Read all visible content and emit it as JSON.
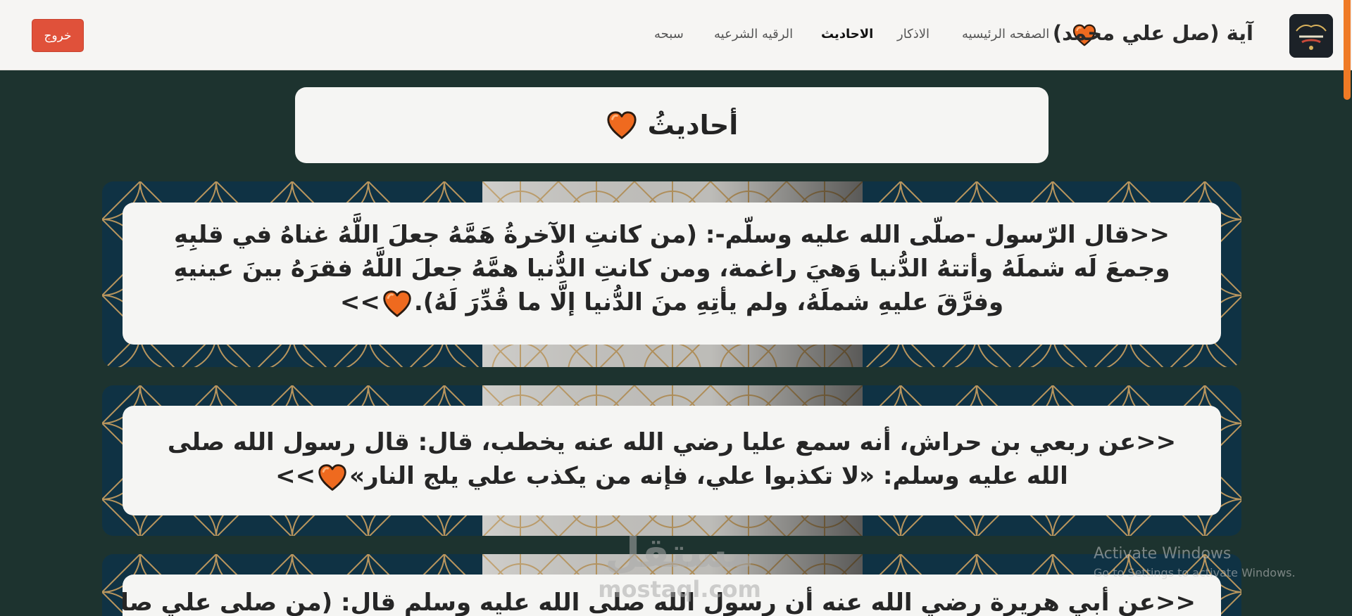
{
  "navbar": {
    "brand_title": "آية (صل علي محمد)",
    "brand_icon": "heart-icon",
    "links": [
      {
        "label": "الصفحه الرئيسيه",
        "active": false
      },
      {
        "label": "الاذكار",
        "active": false
      },
      {
        "label": "الاحاديث",
        "active": true
      },
      {
        "label": "الرقيه الشرعيه",
        "active": false
      },
      {
        "label": "سبحه",
        "active": false
      }
    ],
    "logout_label": "خروج"
  },
  "page": {
    "heading": "أحاديثُ"
  },
  "hadiths": [
    {
      "text": "<<قال الرّسول -صلّى الله عليه وسلّم-: (من كانتِ الآخرةُ هَمَّهُ جعلَ اللَّهُ غناهُ في قلبِهِ وجمعَ لَه شملَهُ وأتتهُ الدُّنيا وَهيَ راغمة، ومن كانتِ الدُّنيا همَّهُ جعلَ اللَّهُ فقرَهُ بينَ عينيهِ وفرَّقَ عليهِ شملَهُ، ولم يأتِهِ منَ الدُّنيا إلَّا ما قُدِّرَ لَهُ)."
    },
    {
      "text": "<<عن ربعي بن حراش، أنه سمع عليا رضي الله عنه يخطب، قال: قال رسول الله صلى الله عليه وسلم: «لا تكذبوا علي، فإنه من يكذب علي يلج النار»"
    },
    {
      "text": "<<عن أبي هريرة رضي الله عنه أن رسول الله صلى الله عليه وسلم قال: (من صلى علي صلاة"
    }
  ],
  "hadith_end_marker": ">>",
  "overlay": {
    "watermark_arabic": "مستقل",
    "watermark_site": "mostaql.com",
    "activate_title": "Activate Windows",
    "activate_subtitle": "Go to Settings to activate Windows."
  },
  "colors": {
    "page_background": "#1d332f",
    "navbar_background": "#f6f5f3",
    "logout_button": "#e0513a",
    "heart": "#ef6a1f",
    "pattern_dark": "#0f3244",
    "pattern_line": "#b8955d",
    "scrollbar": "#ef7a25"
  }
}
